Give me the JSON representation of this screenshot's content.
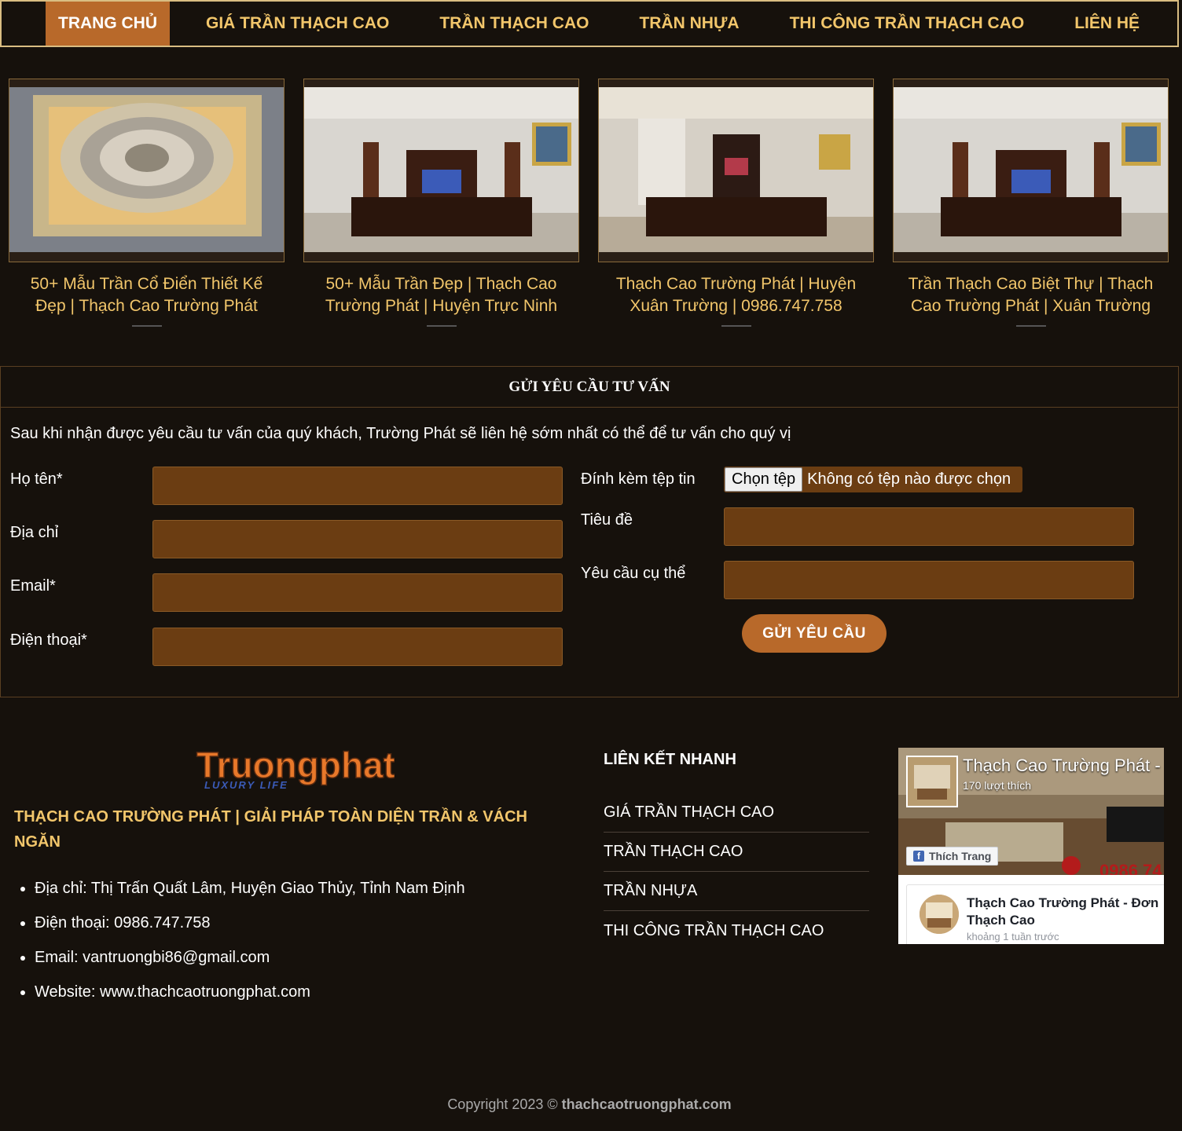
{
  "nav": {
    "items": [
      {
        "label": "TRANG CHỦ",
        "active": true
      },
      {
        "label": "GIÁ TRẦN THẠCH CAO"
      },
      {
        "label": "TRẦN THẠCH CAO"
      },
      {
        "label": "TRẦN NHỰA"
      },
      {
        "label": "THI CÔNG TRẦN THẠCH CAO"
      },
      {
        "label": "LIÊN HỆ"
      }
    ]
  },
  "posts": [
    {
      "title": "50+ Mẫu Trần Cổ Điển Thiết Kế Đẹp | Thạch Cao Trường Phát"
    },
    {
      "title": "50+ Mẫu Trần Đẹp | Thạch Cao Trường Phát | Huyện Trực Ninh"
    },
    {
      "title": "Thạch Cao Trường Phát | Huyện Xuân Trường | 0986.747.758"
    },
    {
      "title": "Trần Thạch Cao Biệt Thự | Thạch Cao Trường Phát | Xuân Trường"
    }
  ],
  "form": {
    "heading": "GỬI YÊU CẦU TƯ VẤN",
    "intro": "Sau khi nhận được yêu cầu tư vấn của quý khách, Trường Phát sẽ liên hệ sớm nhất có thể để tư vấn cho quý vị",
    "name_label": "Họ tên*",
    "address_label": "Địa chỉ",
    "email_label": "Email*",
    "phone_label": "Điện thoại*",
    "attach_label": "Đính kèm tệp tin",
    "file_button": "Chọn tệp",
    "file_status": "Không có tệp nào được chọn",
    "subject_label": "Tiêu đề",
    "request_label": "Yêu cầu cụ thể",
    "submit_label": "GỬI YÊU CẦU"
  },
  "footer": {
    "logo_text": "Truongphat",
    "logo_tagline": "LUXURY LIFE",
    "brand": "THẠCH CAO TRƯỜNG PHÁT | GIẢI PHÁP TOÀN DIỆN TRẦN & VÁCH NGĂN",
    "contact": [
      "Địa chỉ: Thị Trấn Quất Lâm, Huyện Giao Thủy, Tỉnh Nam Định",
      "Điện thoại: 0986.747.758",
      "Email: vantruongbi86@gmail.com",
      "Website: www.thachcaotruongphat.com"
    ],
    "quick_title": "LIÊN KẾT NHANH",
    "quick_links": [
      "GIÁ TRẦN THẠCH CAO",
      "TRẦN THẠCH CAO",
      "TRẦN NHỰA",
      "THI CÔNG TRẦN THẠCH CAO"
    ],
    "facebook": {
      "page_name": "Thạch Cao Trường Phát - ",
      "likes": "170 lượt thích",
      "like_button": "Thích Trang",
      "phone_overlay": "0986 74",
      "post_title_1": "Thạch Cao Trường Phát - Đơn",
      "post_title_2": "Thạch Cao",
      "post_time": "khoảng 1 tuần trước"
    },
    "copyright_prefix": "Copyright 2023 © ",
    "copyright_site": "thachcaotruongphat.com"
  },
  "colors": {
    "accent": "#b8692a",
    "gold": "#f2c66b",
    "input": "#6b3d12",
    "background": "#16110c"
  }
}
